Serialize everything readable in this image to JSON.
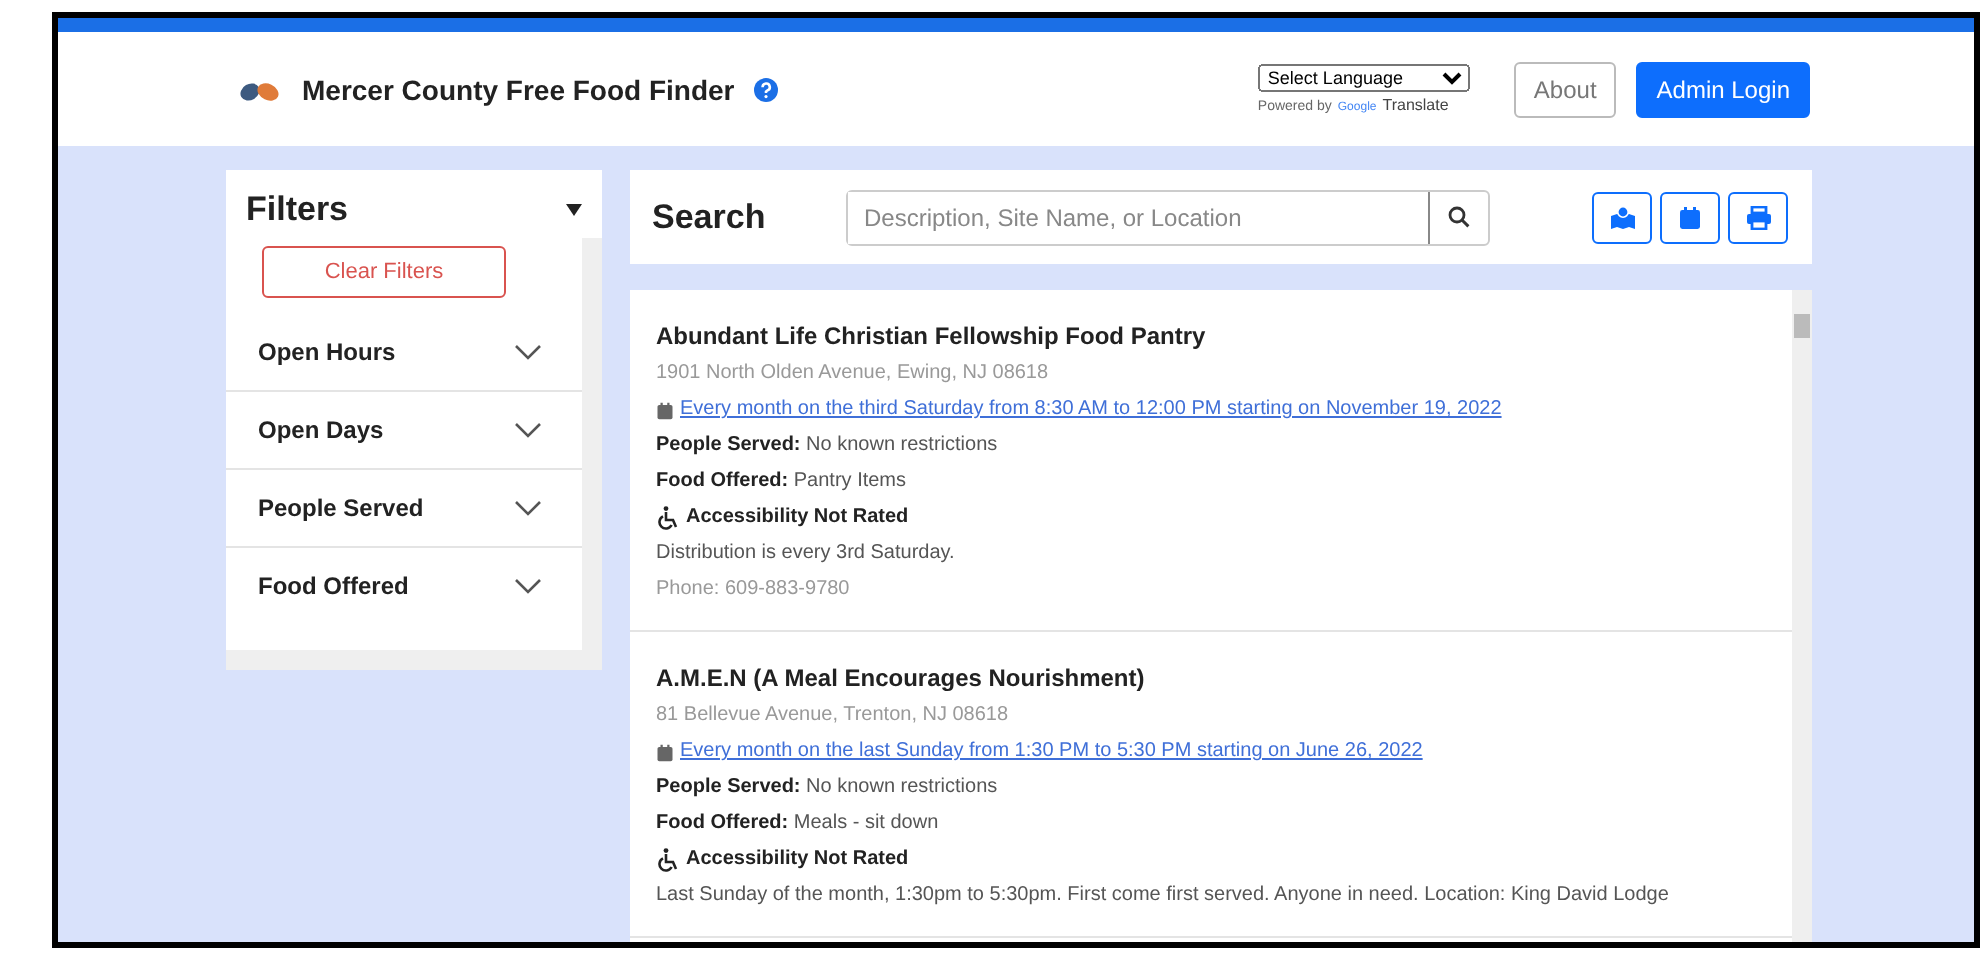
{
  "header": {
    "title": "Mercer County Free Food Finder",
    "language_select": {
      "value": "Select Language"
    },
    "powered_by": "Powered by",
    "translate_brand": "Google",
    "translate_label": "Translate",
    "buttons": [
      {
        "label": "About",
        "kind": "outline"
      },
      {
        "label": "Admin Login",
        "kind": "primary"
      }
    ]
  },
  "filters": {
    "title": "Filters",
    "clear_button": "Clear Filters",
    "sections": [
      {
        "label": "Open Hours",
        "expanded": false
      },
      {
        "label": "Open Days",
        "expanded": false
      },
      {
        "label": "People Served",
        "expanded": false
      },
      {
        "label": "Food Offered",
        "expanded": false
      }
    ]
  },
  "search": {
    "title": "Search",
    "placeholder": "Description, Site Name, or Location"
  },
  "results": [
    {
      "lines": [
        {
          "kind": "title",
          "text": "Abundant Life Christian Fellowship Food Pantry"
        },
        {
          "kind": "address",
          "text": "1901 North Olden Avenue, Ewing, NJ 08618"
        },
        {
          "kind": "schedule",
          "text": "Every month on the third Saturday from 8:30 AM to 12:00 PM starting on November 19, 2022"
        },
        {
          "kind": "detail",
          "text": "**People Served:** No known restrictions"
        },
        {
          "kind": "detail",
          "text": "**Food Offered:** Pantry Items"
        },
        {
          "kind": "accessibility",
          "text": "Accessibility Not Rated"
        },
        {
          "kind": "note",
          "text": "Distribution is every 3rd Saturday."
        },
        {
          "kind": "phone",
          "text": "Phone: 609-883-9780"
        }
      ]
    },
    {
      "lines": [
        {
          "kind": "title",
          "text": "A.M.E.N (A Meal Encourages Nourishment)"
        },
        {
          "kind": "address",
          "text": "81 Bellevue Avenue, Trenton, NJ 08618"
        },
        {
          "kind": "schedule",
          "text": "Every month on the last Sunday from 1:30 PM to 5:30 PM starting on June 26, 2022"
        },
        {
          "kind": "detail",
          "text": "**People Served:** No known restrictions"
        },
        {
          "kind": "detail",
          "text": "**Food Offered:** Meals - sit down"
        },
        {
          "kind": "accessibility",
          "text": "Accessibility Not Rated"
        },
        {
          "kind": "note",
          "text": "Last Sunday of the month, 1:30pm to 5:30pm. First come first served. Anyone in need. Location: King David Lodge"
        }
      ]
    }
  ]
}
